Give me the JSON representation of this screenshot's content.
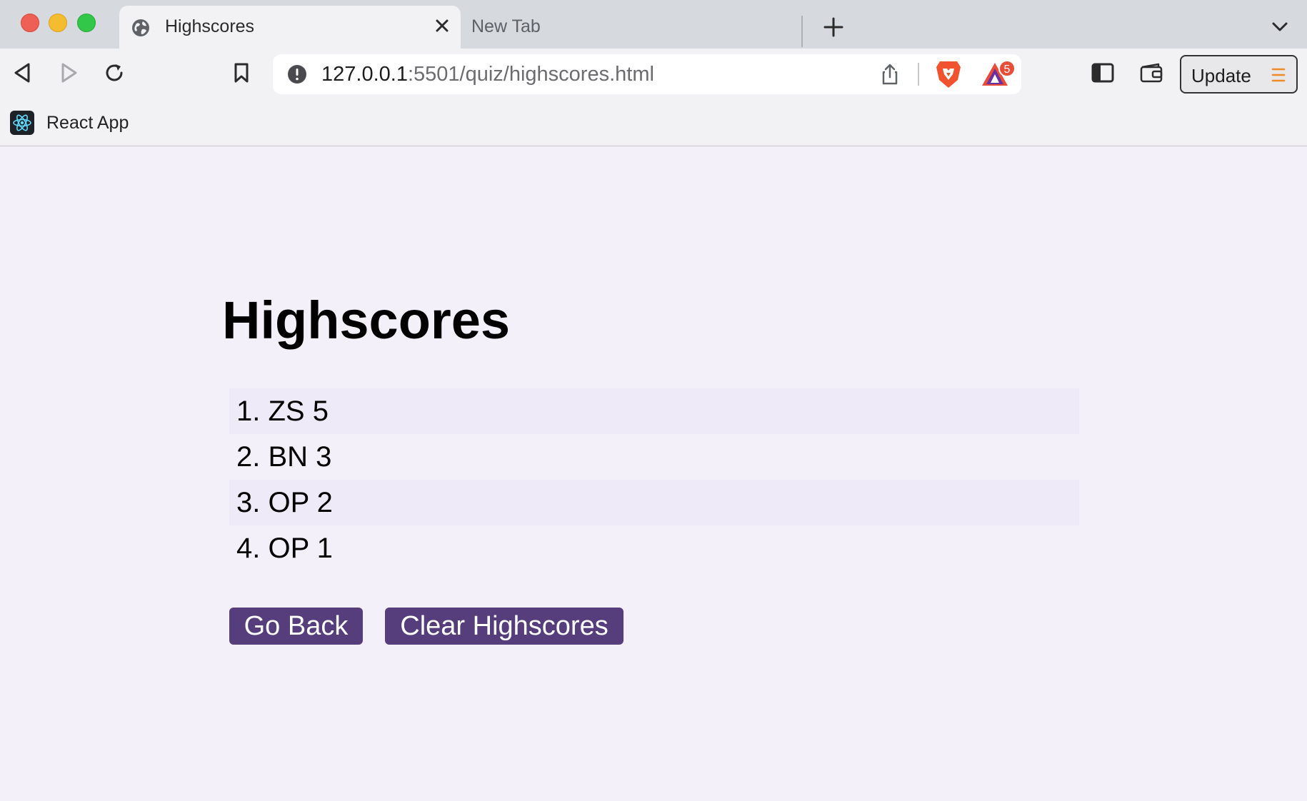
{
  "browser": {
    "active_tab_title": "Highscores",
    "inactive_tab_title": "New Tab",
    "url_host": "127.0.0.1",
    "url_path": ":5501/quiz/highscores.html",
    "rewards_badge": "5",
    "update_label": "Update",
    "bookmark_label": "React App"
  },
  "page": {
    "title": "Highscores",
    "scores": [
      "ZS 5",
      "BN 3",
      "OP 2",
      "OP 1"
    ],
    "go_back_label": "Go Back",
    "clear_label": "Clear Highscores"
  },
  "colors": {
    "button_bg": "#563d7c",
    "page_bg": "#f3f0fa",
    "row_alt_bg": "#eeeaf8"
  }
}
